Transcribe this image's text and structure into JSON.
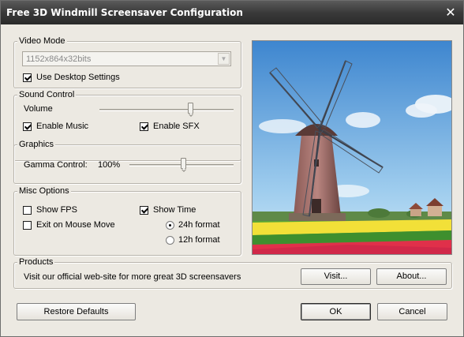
{
  "window": {
    "title": "Free 3D Windmill Screensaver Configuration",
    "close_glyph": "✕"
  },
  "video_mode": {
    "legend": "Video Mode",
    "resolution_value": "1152x864x32bits",
    "use_desktop_label": "Use Desktop Settings",
    "use_desktop_checked": true
  },
  "sound_control": {
    "legend": "Sound Control",
    "volume_label": "Volume",
    "volume_level": 0.68,
    "enable_music_label": "Enable Music",
    "enable_music_checked": true,
    "enable_sfx_label": "Enable SFX",
    "enable_sfx_checked": true
  },
  "graphics": {
    "legend": "Graphics",
    "gamma_label": "Gamma Control:",
    "gamma_value": "100%",
    "gamma_level": 0.52
  },
  "misc_options": {
    "legend": "Misc Options",
    "show_fps_label": "Show FPS",
    "show_fps_checked": false,
    "exit_on_mouse_label": "Exit on Mouse Move",
    "exit_on_mouse_checked": false,
    "show_time_label": "Show Time",
    "show_time_checked": true,
    "format_24h_label": "24h format",
    "format_24h_selected": true,
    "format_12h_label": "12h format",
    "format_12h_selected": false
  },
  "products": {
    "legend": "Products",
    "text": "Visit our official web-site for more great 3D screensavers",
    "visit_label": "Visit...",
    "about_label": "About..."
  },
  "footer": {
    "restore_label": "Restore Defaults",
    "ok_label": "OK",
    "cancel_label": "Cancel"
  },
  "colors": {
    "sky_top": "#3e86cf",
    "sky_bottom": "#bfe0f5",
    "tulip_red": "#e0304a",
    "tulip_yellow": "#f2e038",
    "grass": "#5aa535"
  }
}
